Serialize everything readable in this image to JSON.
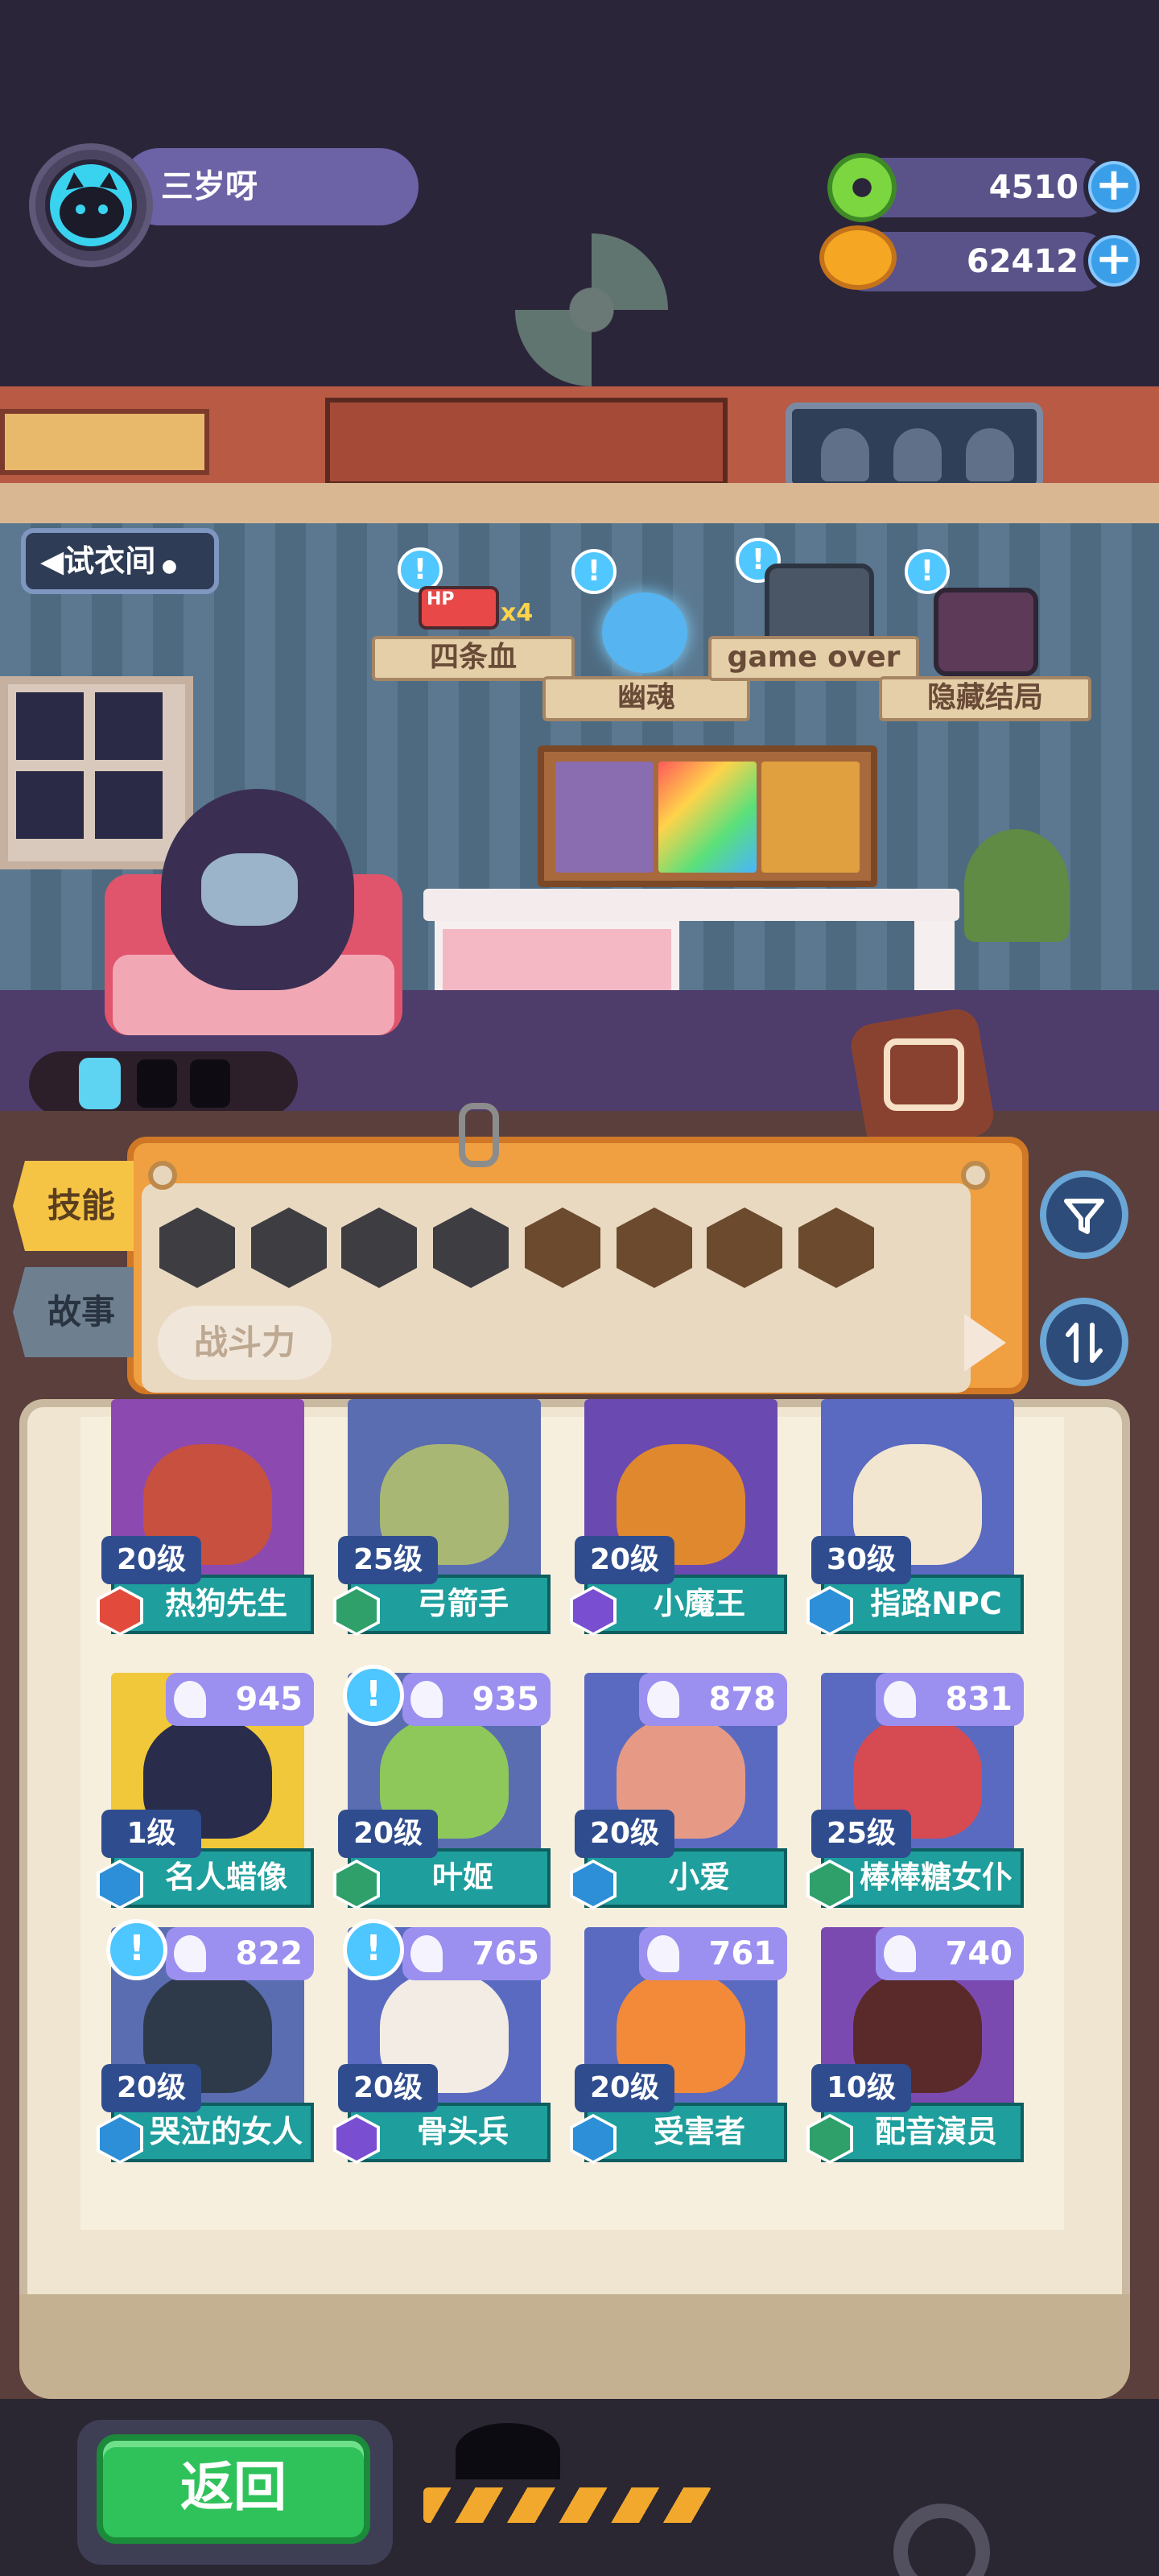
{
  "player": {
    "name": "三岁呀"
  },
  "currencies": [
    {
      "icon": "green-donut-icon",
      "value": "4510",
      "color": "#7bd640"
    },
    {
      "icon": "orange-planet-icon",
      "value": "62412",
      "color": "#f5a623"
    }
  ],
  "room": {
    "dressing_room_label": "试衣间",
    "endings": [
      {
        "label": "四条血",
        "icon": "hp-battery-icon",
        "badge": "x4",
        "hp_text": "HP"
      },
      {
        "label": "幽魂",
        "icon": "ghost-skull-icon"
      },
      {
        "label": "game over",
        "icon": "tombstone-tv-icon"
      },
      {
        "label": "隐藏结局",
        "icon": "tv-portrait-icon"
      }
    ]
  },
  "side_tabs": {
    "skills": "技能",
    "story": "故事"
  },
  "filter_panel": {
    "power_label": "战斗力",
    "badges": [
      {
        "icon": "heart-badge-icon",
        "color": "#3d3d42"
      },
      {
        "icon": "tower-badge-icon",
        "color": "#3d3d42"
      },
      {
        "icon": "shield-badge-icon",
        "color": "#3d3d42"
      },
      {
        "icon": "anchor-badge-icon",
        "color": "#3d3d42"
      },
      {
        "icon": "bust-badge-icon",
        "color": "#6b4a2e"
      },
      {
        "icon": "smile-badge-icon",
        "color": "#6b4a2e"
      },
      {
        "icon": "muscle-badge-icon",
        "color": "#6b4a2e"
      },
      {
        "icon": "brain-badge-icon",
        "color": "#6b4a2e"
      }
    ]
  },
  "cards": [
    {
      "name": "热狗先生",
      "level": "20级",
      "power": "",
      "rarity_color": "#e24b3c",
      "bg": "#8c4ab0",
      "face": "#c8503e",
      "alert": false
    },
    {
      "name": "弓箭手",
      "level": "25级",
      "power": "",
      "rarity_color": "#2fa06a",
      "bg": "#5a6db0",
      "face": "#a8b874",
      "alert": false
    },
    {
      "name": "小魔王",
      "level": "20级",
      "power": "",
      "rarity_color": "#7a4ed0",
      "bg": "#6a4ab0",
      "face": "#e0882e",
      "alert": false
    },
    {
      "name": "指路NPC",
      "level": "30级",
      "power": "",
      "rarity_color": "#2d8fd8",
      "bg": "#5a6ac0",
      "face": "#f2e6d0",
      "alert": false
    },
    {
      "name": "名人蜡像",
      "level": "1级",
      "power": "945",
      "rarity_color": "#2d8fd8",
      "bg": "#f0c83a",
      "face": "#2a2c4c",
      "alert": false
    },
    {
      "name": "叶姬",
      "level": "20级",
      "power": "935",
      "rarity_color": "#2fa06a",
      "bg": "#5a6db0",
      "face": "#8ec85a",
      "alert": true
    },
    {
      "name": "小爱",
      "level": "20级",
      "power": "878",
      "rarity_color": "#2d8fd8",
      "bg": "#5a6ac0",
      "face": "#e69a86",
      "alert": false
    },
    {
      "name": "棒棒糖女仆",
      "level": "25级",
      "power": "831",
      "rarity_color": "#2fa06a",
      "bg": "#5a6ac0",
      "face": "#d64a52",
      "alert": false
    },
    {
      "name": "哭泣的女人",
      "level": "20级",
      "power": "822",
      "rarity_color": "#2d8fd8",
      "bg": "#5a6db0",
      "face": "#2e3a4a",
      "alert": true
    },
    {
      "name": "骨头兵",
      "level": "20级",
      "power": "765",
      "rarity_color": "#7a4ed0",
      "bg": "#5a6ac0",
      "face": "#f2ece4",
      "alert": true
    },
    {
      "name": "受害者",
      "level": "20级",
      "power": "761",
      "rarity_color": "#2d8fd8",
      "bg": "#5a6ac0",
      "face": "#f28a3a",
      "alert": false
    },
    {
      "name": "配音演员",
      "level": "10级",
      "power": "740",
      "rarity_color": "#2fa06a",
      "bg": "#7a4ab0",
      "face": "#5a2a2a",
      "alert": false
    }
  ],
  "buttons": {
    "return_label": "返回",
    "filter_icon": "funnel-icon",
    "sort_icon": "sort-arrows-icon"
  }
}
